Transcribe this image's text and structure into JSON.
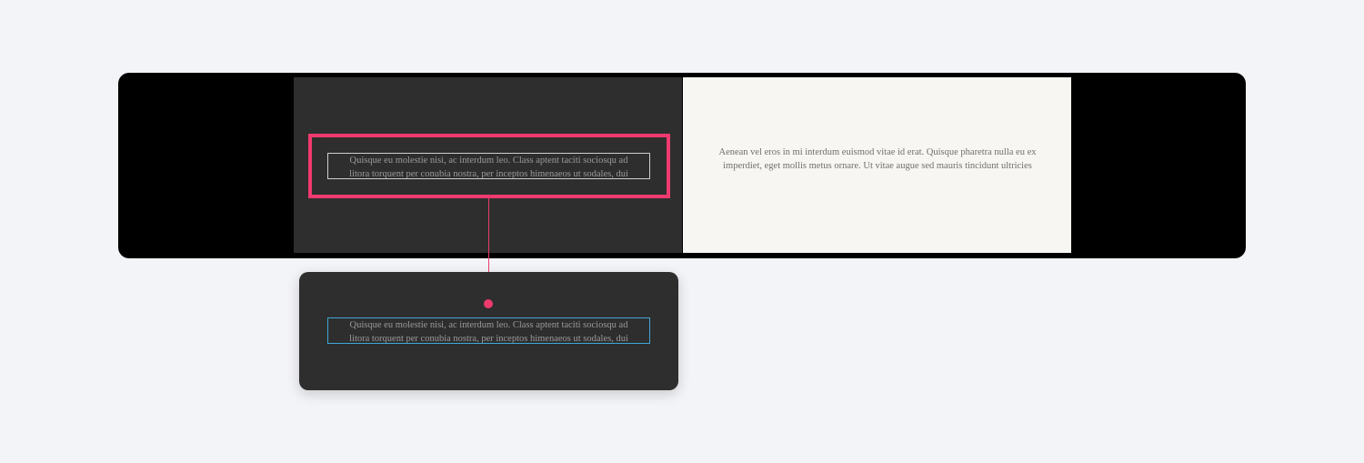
{
  "canvas": {
    "background": "#f3f4f8",
    "frame_color": "#000000",
    "accent_color": "#ee3a6f",
    "preview_border_color": "#3fa7d6"
  },
  "slides": {
    "dark_panel": {
      "background": "#2e2e2e",
      "text_lines": [
        "Quisque eu molestie nisi, ac interdum leo. Class aptent taciti sociosqu ad",
        "litora torquent per conubia nostra, per inceptos himenaeos ut sodales, dui"
      ]
    },
    "light_panel": {
      "background": "#f7f6f2",
      "text": "Aenean vel eros in mi interdum euismod vitae id erat. Quisque pharetra nulla eu ex imperdiet, eget mollis metus ornare. Ut vitae augue sed mauris tincidunt ultricies"
    }
  },
  "preview": {
    "text_lines": [
      "Quisque eu molestie nisi, ac interdum leo. Class aptent taciti sociosqu ad",
      "litora torquent per conubia nostra, per inceptos himenaeos ut sodales, dui"
    ]
  }
}
